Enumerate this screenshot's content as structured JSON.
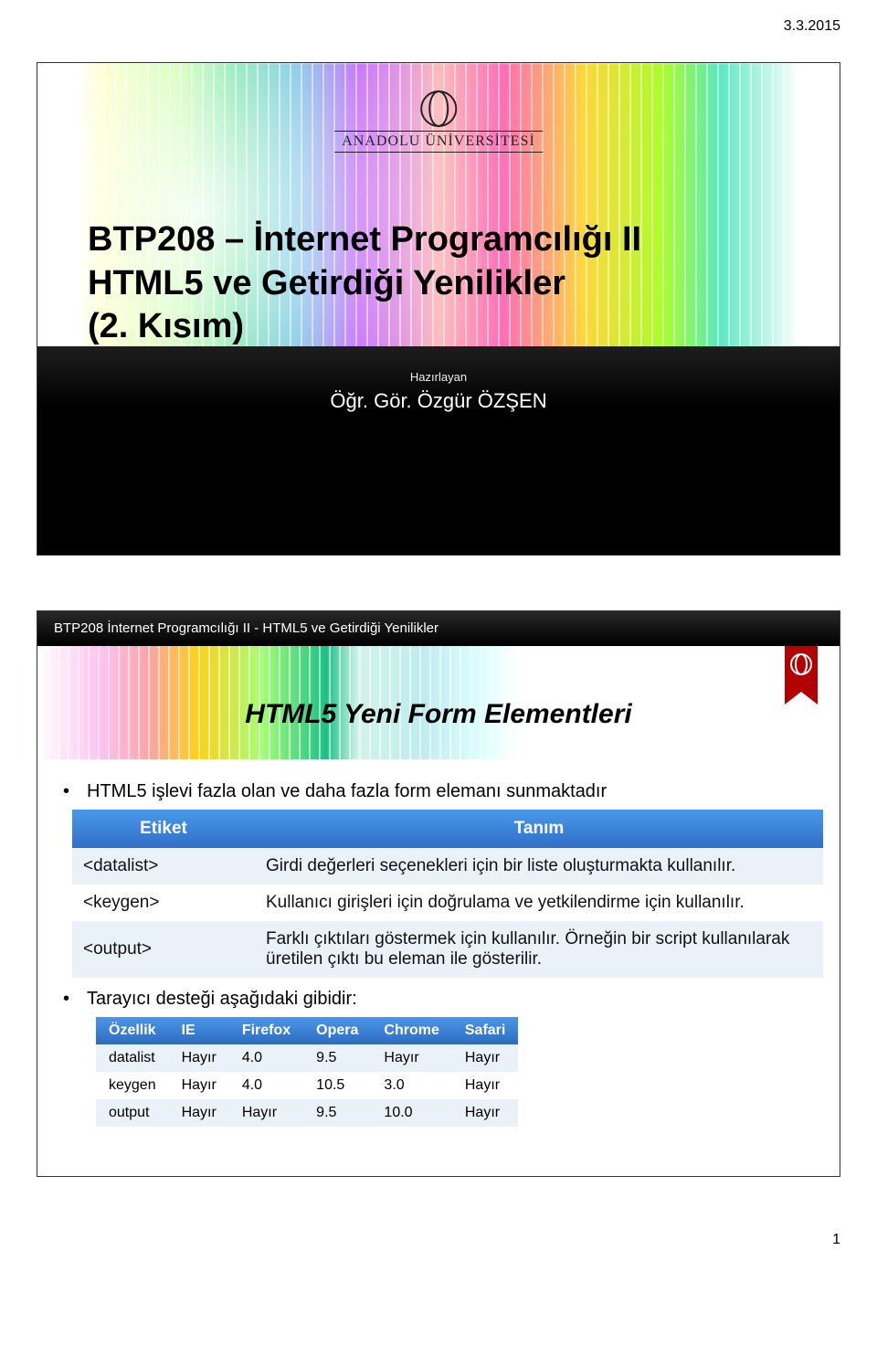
{
  "page_date": "3.3.2015",
  "page_number": "1",
  "university": "ANADOLU ÜNİVERSİTESİ",
  "slide1": {
    "title_line1": "BTP208 – İnternet Programcılığı II",
    "title_line2": "HTML5 ve Getirdiği Yenilikler",
    "title_line3": "(2. Kısım)",
    "prepared_by_label": "Hazırlayan",
    "author": "Öğr. Gör. Özgür ÖZŞEN"
  },
  "slide2": {
    "header": "BTP208 İnternet Programcılığı II - HTML5 ve Getirdiği Yenilikler",
    "title": "HTML5 Yeni Form Elementleri",
    "bullet1": "HTML5 işlevi fazla olan ve daha fazla form elemanı sunmaktadır",
    "table1": {
      "col1": "Etiket",
      "col2": "Tanım",
      "rows": [
        {
          "tag": "<datalist>",
          "desc": "Girdi değerleri seçenekleri için bir liste oluşturmakta kullanılır."
        },
        {
          "tag": "<keygen>",
          "desc": "Kullanıcı girişleri için doğrulama ve yetkilendirme için kullanılır."
        },
        {
          "tag": "<output>",
          "desc": "Farklı çıktıları göstermek için kullanılır. Örneğin bir script kullanılarak üretilen çıktı bu eleman ile gösterilir."
        }
      ]
    },
    "bullet2": "Tarayıcı desteği aşağıdaki gibidir:",
    "table2": {
      "cols": [
        "Özellik",
        "IE",
        "Firefox",
        "Opera",
        "Chrome",
        "Safari"
      ],
      "rows": [
        [
          "datalist",
          "Hayır",
          "4.0",
          "9.5",
          "Hayır",
          "Hayır"
        ],
        [
          "keygen",
          "Hayır",
          "4.0",
          "10.5",
          "3.0",
          "Hayır"
        ],
        [
          "output",
          "Hayır",
          "Hayır",
          "9.5",
          "10.0",
          "Hayır"
        ]
      ]
    }
  },
  "chart_data": [
    {
      "type": "table",
      "title": "HTML5 Yeni Form Elementleri – Etiket / Tanım",
      "columns": [
        "Etiket",
        "Tanım"
      ],
      "rows": [
        [
          "<datalist>",
          "Girdi değerleri seçenekleri için bir liste oluşturmakta kullanılır."
        ],
        [
          "<keygen>",
          "Kullanıcı girişleri için doğrulama ve yetkilendirme için kullanılır."
        ],
        [
          "<output>",
          "Farklı çıktıları göstermek için kullanılır. Örneğin bir script kullanılarak üretilen çıktı bu eleman ile gösterilir."
        ]
      ]
    },
    {
      "type": "table",
      "title": "Tarayıcı desteği",
      "columns": [
        "Özellik",
        "IE",
        "Firefox",
        "Opera",
        "Chrome",
        "Safari"
      ],
      "rows": [
        [
          "datalist",
          "Hayır",
          "4.0",
          "9.5",
          "Hayır",
          "Hayır"
        ],
        [
          "keygen",
          "Hayır",
          "4.0",
          "10.5",
          "3.0",
          "Hayır"
        ],
        [
          "output",
          "Hayır",
          "Hayır",
          "9.5",
          "10.0",
          "Hayır"
        ]
      ]
    }
  ]
}
